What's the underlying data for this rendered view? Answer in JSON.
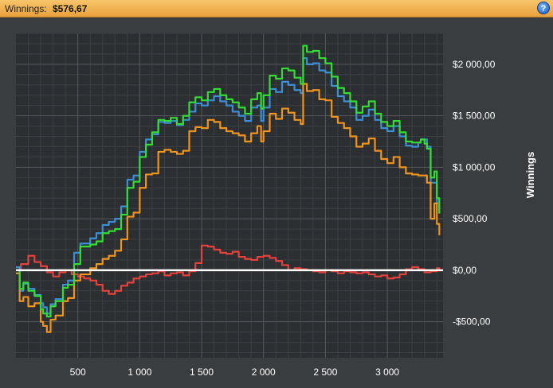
{
  "header": {
    "label": "Winnings:",
    "value": "$576,67",
    "help_icon": "?"
  },
  "chart_data": {
    "type": "line",
    "ylabel": "Winnings",
    "xlabel": "",
    "xlim": [
      0,
      3450
    ],
    "ylim": [
      -850,
      2300
    ],
    "x_ticks": [
      500,
      1000,
      1500,
      2000,
      2500,
      3000
    ],
    "x_tick_labels": [
      "500",
      "1 000",
      "1 500",
      "2 000",
      "2 500",
      "3 000"
    ],
    "y_ticks": [
      2000,
      1500,
      1000,
      500,
      0,
      -500
    ],
    "y_tick_labels": [
      "$2 000,00",
      "$1 500,00",
      "$1 000,00",
      "$500,00",
      "$0,00",
      "-$500,00"
    ],
    "grid": true,
    "zero_line": true,
    "series": [
      {
        "color": "#e8413c",
        "x": [
          0,
          40,
          100,
          150,
          200,
          250,
          300,
          350,
          400,
          450,
          500,
          550,
          600,
          650,
          700,
          750,
          800,
          850,
          900,
          950,
          1000,
          1050,
          1100,
          1150,
          1200,
          1250,
          1300,
          1350,
          1400,
          1450,
          1500,
          1550,
          1600,
          1650,
          1700,
          1750,
          1800,
          1850,
          1900,
          1950,
          2000,
          2050,
          2100,
          2150,
          2200,
          2250,
          2300,
          2350,
          2400,
          2450,
          2500,
          2550,
          2600,
          2650,
          2700,
          2750,
          2800,
          2850,
          2900,
          2950,
          3000,
          3050,
          3100,
          3150,
          3200,
          3250,
          3300,
          3350,
          3400,
          3420
        ],
        "y": [
          0,
          60,
          140,
          80,
          40,
          -20,
          -60,
          -20,
          0,
          -40,
          -60,
          -80,
          -100,
          -140,
          -200,
          -230,
          -200,
          -150,
          -120,
          -80,
          -60,
          -40,
          -30,
          -10,
          -50,
          -30,
          -20,
          -50,
          -10,
          70,
          240,
          230,
          200,
          170,
          160,
          180,
          130,
          110,
          100,
          130,
          140,
          120,
          90,
          50,
          0,
          20,
          10,
          0,
          -10,
          -20,
          0,
          -10,
          -30,
          -10,
          -20,
          -30,
          -20,
          -40,
          -60,
          -50,
          -80,
          -70,
          -40,
          10,
          30,
          10,
          -20,
          -10,
          20,
          -10
        ]
      },
      {
        "color": "#3a8fd8",
        "x": [
          0,
          30,
          60,
          100,
          150,
          200,
          220,
          250,
          280,
          320,
          380,
          420,
          470,
          520,
          600,
          650,
          700,
          750,
          800,
          850,
          900,
          950,
          1000,
          1050,
          1100,
          1150,
          1200,
          1250,
          1300,
          1350,
          1400,
          1450,
          1500,
          1550,
          1600,
          1650,
          1700,
          1750,
          1800,
          1850,
          1900,
          1950,
          1980,
          2000,
          2050,
          2100,
          2150,
          2200,
          2250,
          2300,
          2320,
          2350,
          2400,
          2450,
          2500,
          2550,
          2600,
          2650,
          2700,
          2750,
          2800,
          2850,
          2900,
          2950,
          3000,
          3050,
          3100,
          3150,
          3200,
          3250,
          3270,
          3300,
          3320,
          3350,
          3380,
          3400,
          3420
        ],
        "y": [
          30,
          -200,
          -130,
          -180,
          -240,
          -320,
          -360,
          -420,
          -330,
          -280,
          -140,
          -100,
          170,
          260,
          310,
          360,
          440,
          470,
          500,
          620,
          880,
          920,
          1150,
          1270,
          1320,
          1440,
          1430,
          1450,
          1410,
          1460,
          1540,
          1620,
          1600,
          1650,
          1690,
          1640,
          1600,
          1540,
          1500,
          1450,
          1580,
          1600,
          1450,
          1580,
          1760,
          1730,
          1830,
          1800,
          1750,
          1720,
          2060,
          2000,
          2010,
          1940,
          1920,
          1790,
          1690,
          1640,
          1580,
          1460,
          1500,
          1560,
          1460,
          1380,
          1350,
          1400,
          1300,
          1210,
          1200,
          1240,
          1270,
          1270,
          1200,
          850,
          850,
          650,
          560
        ]
      },
      {
        "color": "#f0941e",
        "x": [
          0,
          30,
          60,
          100,
          150,
          200,
          220,
          250,
          280,
          320,
          380,
          420,
          470,
          520,
          600,
          650,
          700,
          750,
          800,
          850,
          900,
          950,
          1000,
          1050,
          1100,
          1150,
          1200,
          1250,
          1300,
          1350,
          1400,
          1450,
          1500,
          1550,
          1600,
          1650,
          1700,
          1750,
          1800,
          1850,
          1900,
          1950,
          1980,
          2000,
          2050,
          2100,
          2150,
          2200,
          2250,
          2300,
          2320,
          2350,
          2400,
          2450,
          2500,
          2550,
          2600,
          2650,
          2700,
          2750,
          2800,
          2850,
          2900,
          2950,
          3000,
          3050,
          3100,
          3150,
          3200,
          3250,
          3270,
          3300,
          3320,
          3350,
          3380,
          3400,
          3420
        ],
        "y": [
          -30,
          -300,
          -260,
          -350,
          -320,
          -500,
          -540,
          -600,
          -480,
          -440,
          -300,
          -270,
          -100,
          -40,
          20,
          60,
          110,
          140,
          190,
          300,
          520,
          560,
          800,
          930,
          940,
          1150,
          1170,
          1150,
          1130,
          1160,
          1350,
          1390,
          1380,
          1460,
          1440,
          1380,
          1350,
          1330,
          1310,
          1250,
          1330,
          1400,
          1250,
          1350,
          1520,
          1470,
          1570,
          1530,
          1460,
          1420,
          1810,
          1740,
          1750,
          1660,
          1650,
          1490,
          1430,
          1380,
          1300,
          1200,
          1230,
          1280,
          1160,
          1080,
          1040,
          1100,
          1000,
          940,
          930,
          920,
          920,
          920,
          850,
          500,
          650,
          450,
          340
        ]
      },
      {
        "color": "#33dd33",
        "x": [
          0,
          30,
          60,
          100,
          150,
          200,
          220,
          250,
          280,
          320,
          380,
          420,
          470,
          520,
          600,
          650,
          700,
          750,
          800,
          850,
          900,
          950,
          1000,
          1050,
          1100,
          1150,
          1200,
          1250,
          1300,
          1350,
          1400,
          1450,
          1500,
          1550,
          1600,
          1650,
          1700,
          1750,
          1800,
          1850,
          1900,
          1950,
          1980,
          2000,
          2050,
          2100,
          2150,
          2200,
          2250,
          2300,
          2320,
          2350,
          2400,
          2450,
          2500,
          2550,
          2600,
          2650,
          2700,
          2750,
          2800,
          2850,
          2900,
          2950,
          3000,
          3050,
          3100,
          3150,
          3200,
          3250,
          3270,
          3300,
          3320,
          3350,
          3380,
          3400,
          3420
        ],
        "y": [
          0,
          -180,
          -120,
          -200,
          -250,
          -380,
          -420,
          -450,
          -350,
          -300,
          -170,
          -140,
          60,
          230,
          250,
          280,
          360,
          380,
          400,
          540,
          800,
          860,
          1100,
          1220,
          1340,
          1460,
          1450,
          1480,
          1420,
          1500,
          1630,
          1680,
          1650,
          1730,
          1760,
          1700,
          1660,
          1630,
          1580,
          1520,
          1660,
          1720,
          1570,
          1700,
          1890,
          1860,
          1960,
          1940,
          1870,
          1810,
          2180,
          2120,
          2130,
          2060,
          2010,
          1880,
          1770,
          1720,
          1640,
          1530,
          1590,
          1640,
          1520,
          1440,
          1400,
          1450,
          1340,
          1250,
          1240,
          1240,
          1270,
          1230,
          1180,
          900,
          960,
          700,
          550
        ]
      }
    ]
  },
  "colors": {
    "header_bg": "#f0ac4a",
    "panel_bg": "#3a3d40",
    "plot_bg": "#2c2f32",
    "grid_major": "#55595d",
    "grid_minor": "#3b3f43",
    "zero_line": "#ffffff"
  }
}
